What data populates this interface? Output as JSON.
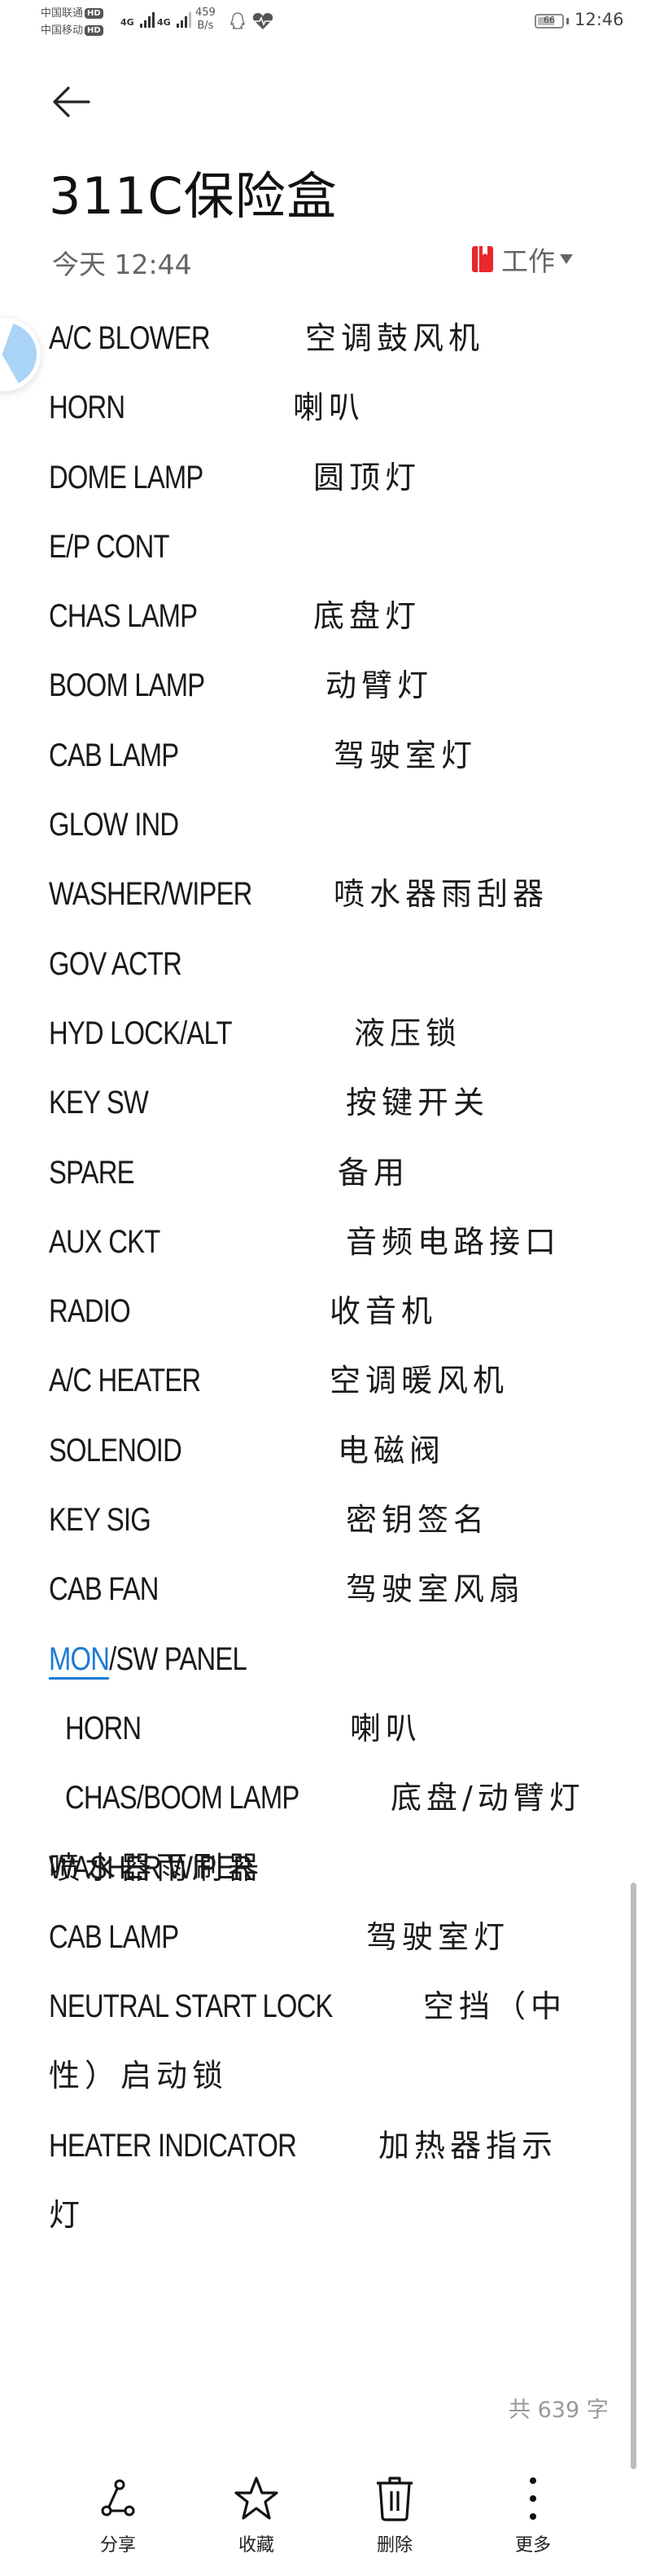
{
  "status_bar": {
    "carrier_1": "中国联通",
    "carrier_2": "中国移动",
    "hd_badge": "HD",
    "network_1": "4G",
    "network_2": "4G",
    "speed_value": "459",
    "speed_unit": "B/s",
    "battery_level": "66",
    "time": "12:46",
    "icons": [
      "qq-icon",
      "health-heart-icon"
    ]
  },
  "header": {
    "back_icon": "arrow-left-icon",
    "title": "311C保险盒",
    "date": "今天 12:44",
    "folder_label": "工作",
    "folder_icon": "notebook-icon",
    "folder_color": "#e8282b"
  },
  "note": {
    "rows": [
      {
        "en": "A/C  BLOWER",
        "zh": "空调鼓风机"
      },
      {
        "en": "HORN",
        "zh": "喇叭"
      },
      {
        "en": "DOME LAMP",
        "zh": "圆顶灯"
      },
      {
        "en": "E/P CONT",
        "zh": ""
      },
      {
        "en": "CHAS LAMP",
        "zh": "底盘灯"
      },
      {
        "en": "BOOM LAMP",
        "zh": "动臂灯"
      },
      {
        "en": "CAB LAMP",
        "zh": "驾驶室灯"
      },
      {
        "en": "GLOW IND",
        "zh": ""
      },
      {
        "en": "WASHER/WIPER",
        "zh": "喷水器雨刮器"
      },
      {
        "en": "GOV ACTR",
        "zh": ""
      },
      {
        "en": "HYD LOCK/ALT",
        "zh": "液压锁"
      },
      {
        "en": "KEY SW",
        "zh": "按键开关"
      },
      {
        "en": "SPARE",
        "zh": "备用"
      },
      {
        "en": "AUX CKT",
        "zh": "音频电路接口"
      },
      {
        "en": "RADIO",
        "zh": "收音机"
      },
      {
        "en": "A/C HEATER",
        "zh": "空调暖风机"
      },
      {
        "en": "SOLENOID",
        "zh": "电磁阀"
      },
      {
        "en": "KEY SIG",
        "zh": "密钥签名"
      },
      {
        "en": "CAB FAN",
        "zh": "驾驶室风扇"
      },
      {
        "en_link": "MON",
        "en": "/SW PANEL",
        "zh": ""
      },
      {
        "en": "HORN",
        "zh": "喇叭",
        "indent": true
      },
      {
        "en": "CHAS/BOOM  LAMP",
        "zh": "底盘/动臂灯",
        "indent": true
      },
      {
        "en": "WASHER WIPER",
        "zh": "喷水器雨刷器"
      },
      {
        "en": "CAB LAMP",
        "zh": "驾驶室灯"
      },
      {
        "en": "NEUTRAL START LOCK",
        "zh": "空挡（中"
      },
      {
        "en": "",
        "zh": "性）启动锁"
      },
      {
        "en": "HEATER INDICATOR",
        "zh": "加热器指示"
      },
      {
        "en": "",
        "zh": "灯"
      }
    ],
    "link_color": "#1e7ad6"
  },
  "word_count": "共 639 字",
  "toolbar": {
    "items": [
      {
        "label": "分享",
        "icon": "share-icon"
      },
      {
        "label": "收藏",
        "icon": "star-icon"
      },
      {
        "label": "删除",
        "icon": "trash-icon"
      },
      {
        "label": "更多",
        "icon": "more-vertical-icon"
      }
    ]
  }
}
